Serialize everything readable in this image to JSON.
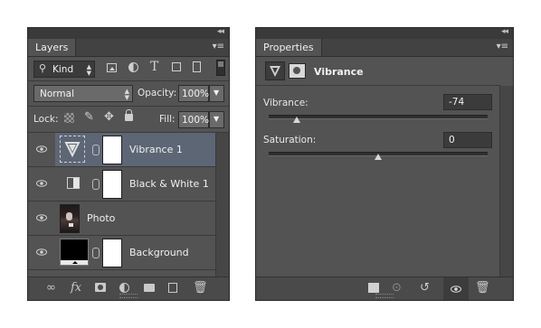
{
  "layers_panel": {
    "collapse_glyph": "◂◂",
    "tab": "Layers",
    "menu_glyph": "▾≡",
    "filter_kind": "Kind",
    "blend_mode": "Normal",
    "opacity_label": "Opacity:",
    "opacity_value": "100%",
    "lock_label": "Lock:",
    "fill_label": "Fill:",
    "fill_value": "100%",
    "filter_icons": [
      "image-filter-icon",
      "adjustment-filter-icon",
      "type-filter-icon",
      "shape-filter-icon",
      "smart-object-filter-icon",
      "filter-toggle-icon"
    ],
    "type_glyph": "T",
    "layers": [
      {
        "name": "Vibrance 1",
        "selected": true
      },
      {
        "name": "Black & White 1",
        "selected": false
      },
      {
        "name": "Photo",
        "selected": false
      },
      {
        "name": "Background",
        "selected": false
      }
    ],
    "bottom_icons": [
      "link-layers-icon",
      "fx-icon",
      "add-mask-icon",
      "new-adjustment-icon",
      "new-group-icon",
      "new-layer-icon",
      "delete-layer-icon"
    ]
  },
  "properties_panel": {
    "collapse_glyph": "◂◂",
    "tab": "Properties",
    "menu_glyph": "▾≡",
    "title": "Vibrance",
    "vibrance_label": "Vibrance:",
    "vibrance_value": "-74",
    "vibrance_level": -74,
    "saturation_label": "Saturation:",
    "saturation_value": "0",
    "saturation_level": 0,
    "bottom_icons": [
      "clip-to-layer-icon",
      "view-previous-icon",
      "reset-icon",
      "visibility-icon",
      "delete-icon"
    ]
  }
}
